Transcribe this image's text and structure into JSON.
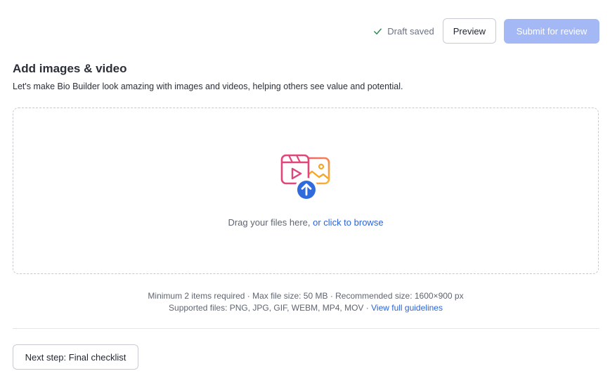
{
  "header": {
    "draft_status": "Draft saved",
    "preview_label": "Preview",
    "submit_label": "Submit for review"
  },
  "section": {
    "title": "Add images & video",
    "subtitle": "Let's make Bio Builder look amazing with images and videos, helping others see value and potential."
  },
  "dropzone": {
    "text": "Drag your files here, ",
    "browse_link": "or click to browse",
    "icons": [
      "media-upload-illustration",
      "video-icon",
      "image-icon",
      "upload-arrow-icon"
    ]
  },
  "requirements": {
    "line1": "Minimum 2 items required · Max file size: 50 MB · Recommended size: 1600×900 px",
    "line2": "Supported files: PNG, JPG, GIF, WEBM, MP4, MOV · ",
    "guidelines_link": "View full guidelines"
  },
  "footer": {
    "next_step_label": "Next step: Final checklist"
  },
  "colors": {
    "accent": "#2b62d9",
    "submit_disabled": "#a3b8f5",
    "success": "#2e8b57",
    "video_icon": "#e0457b",
    "image_icon": "#f5a623",
    "upload_badge": "#2f6bdc"
  }
}
